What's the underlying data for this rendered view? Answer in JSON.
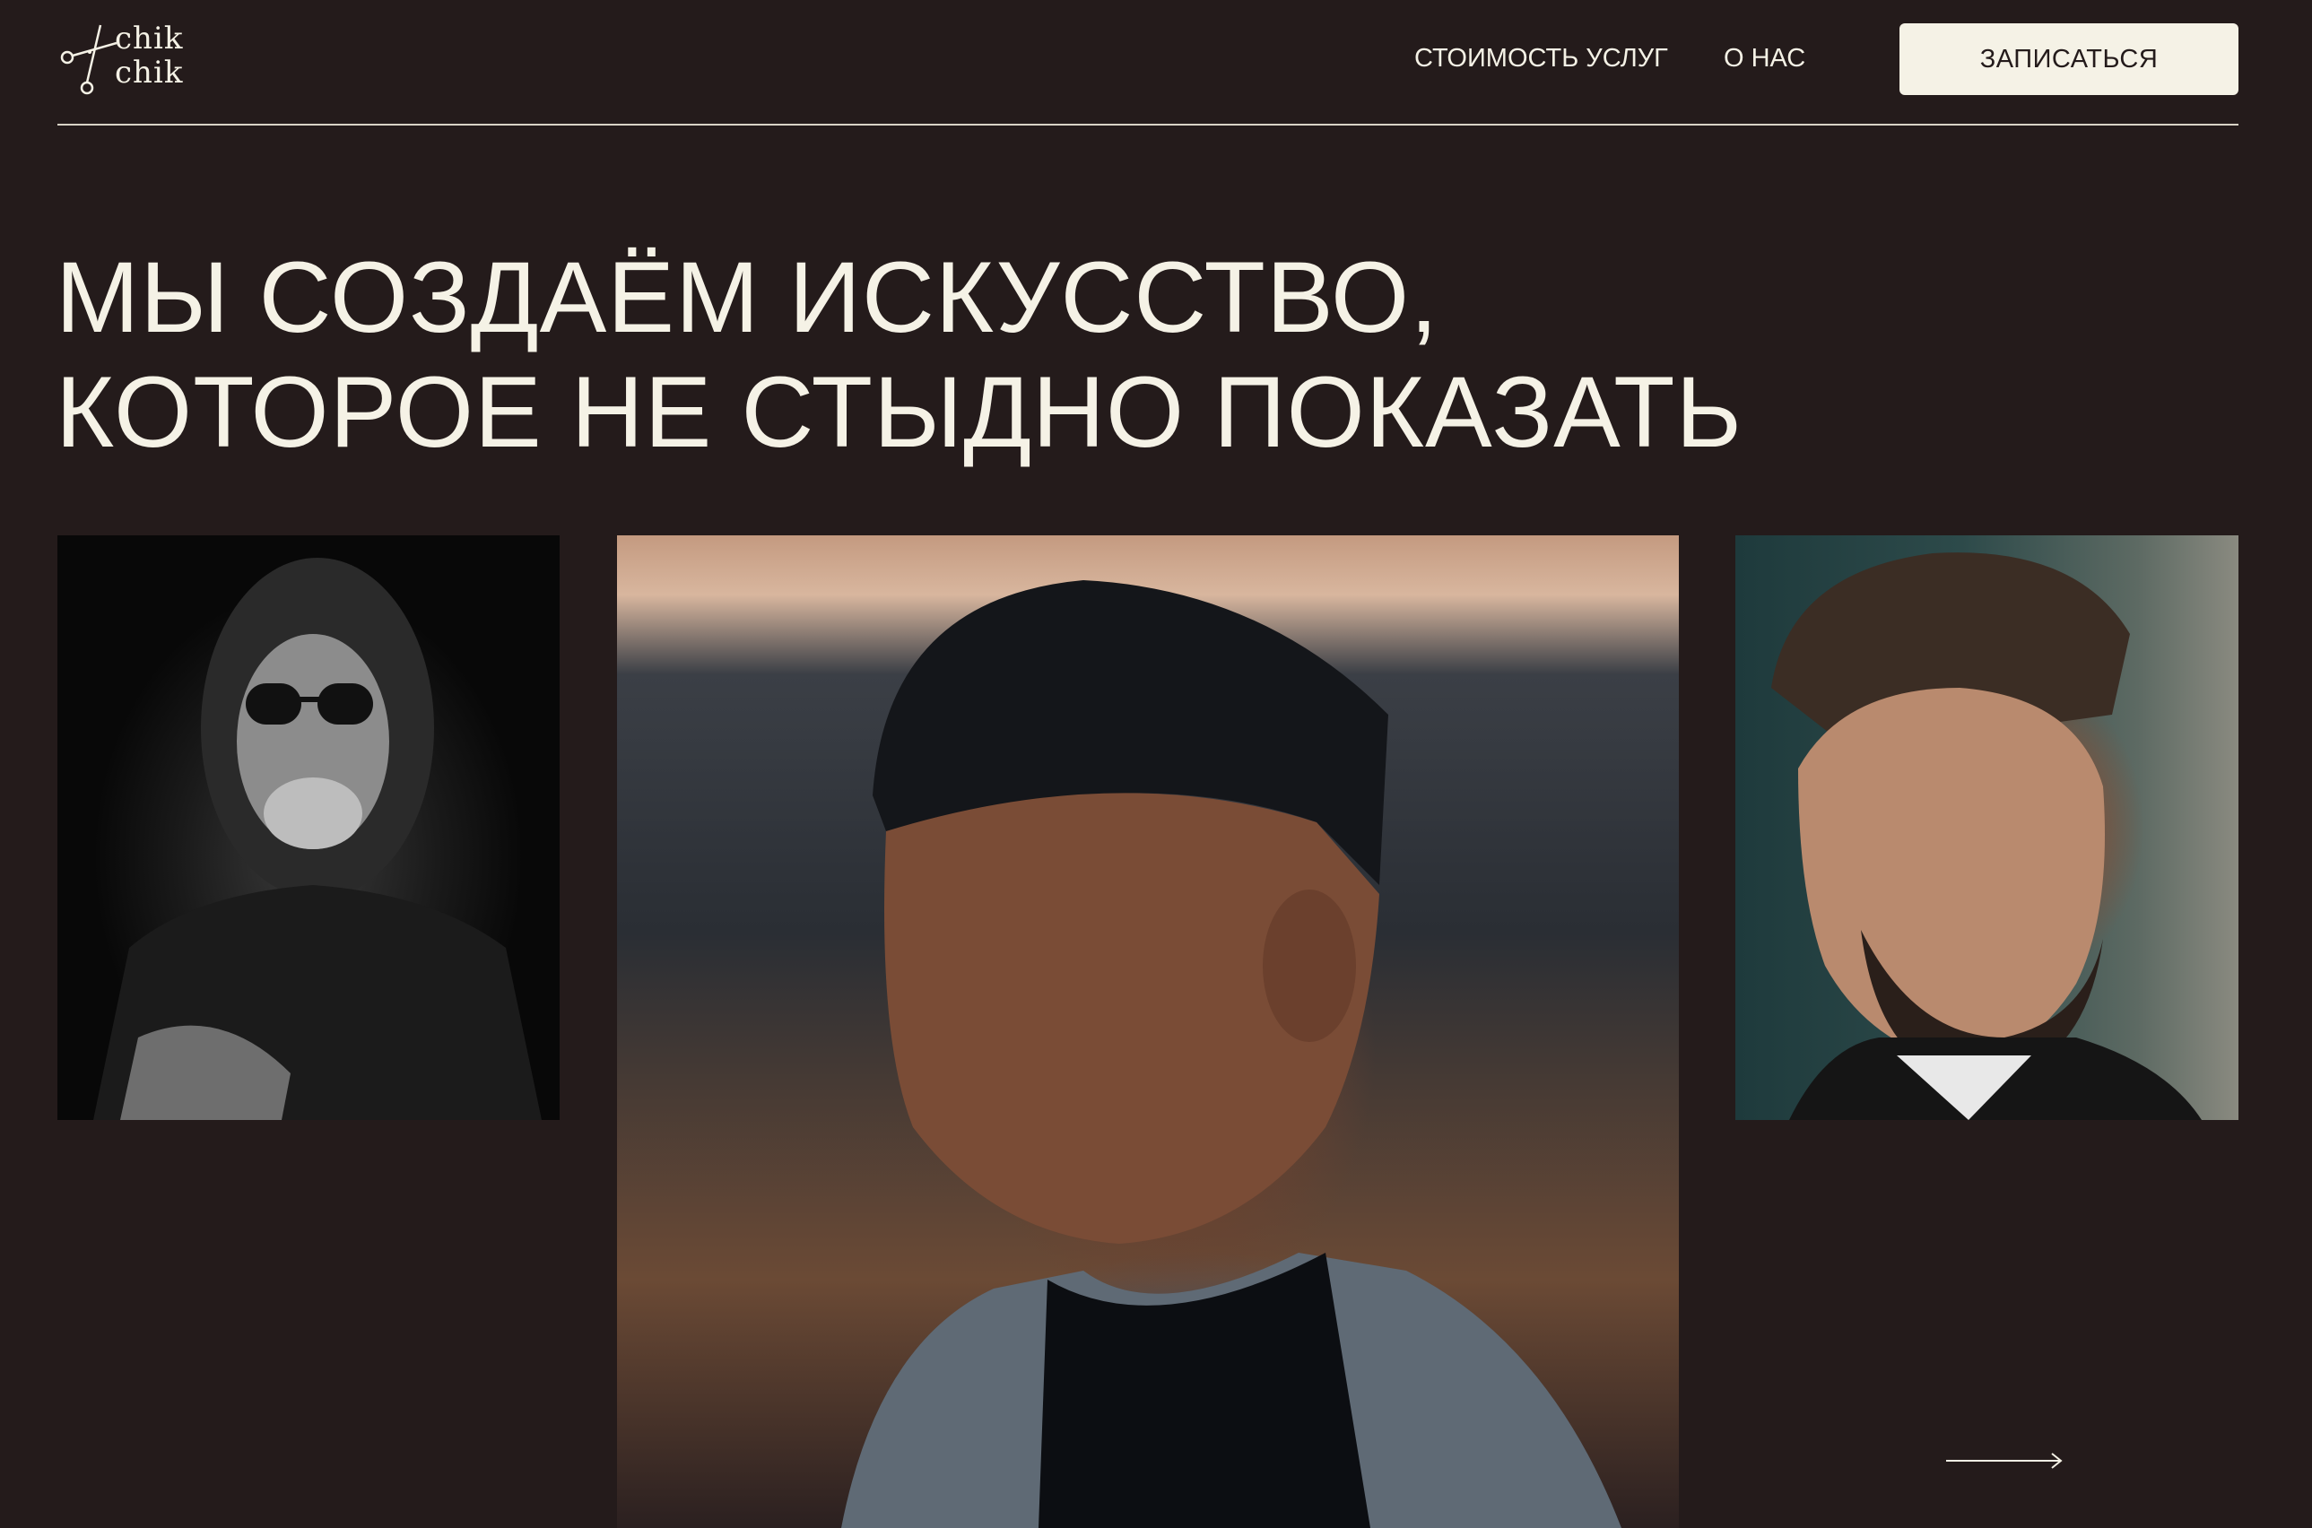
{
  "header": {
    "logo": {
      "line1": "chik",
      "line2": "chik",
      "icon": "scissors-icon"
    },
    "nav": [
      {
        "label": "СТОИМОСТЬ УСЛУГ"
      },
      {
        "label": "О НАС"
      }
    ],
    "cta_label": "ЗАПИСАТЬСЯ"
  },
  "hero": {
    "title_line1": "МЫ СОЗДАЁМ ИСКУССТВО,",
    "title_line2": "КОТОРОЕ НЕ СТЫДНО ПОКАЗАТЬ"
  },
  "gallery": {
    "next_icon": "arrow-right-icon"
  },
  "colors": {
    "background": "#241b1b",
    "text": "#f5f2e6",
    "button_bg": "#f5f2e6",
    "button_text": "#241b1b"
  }
}
